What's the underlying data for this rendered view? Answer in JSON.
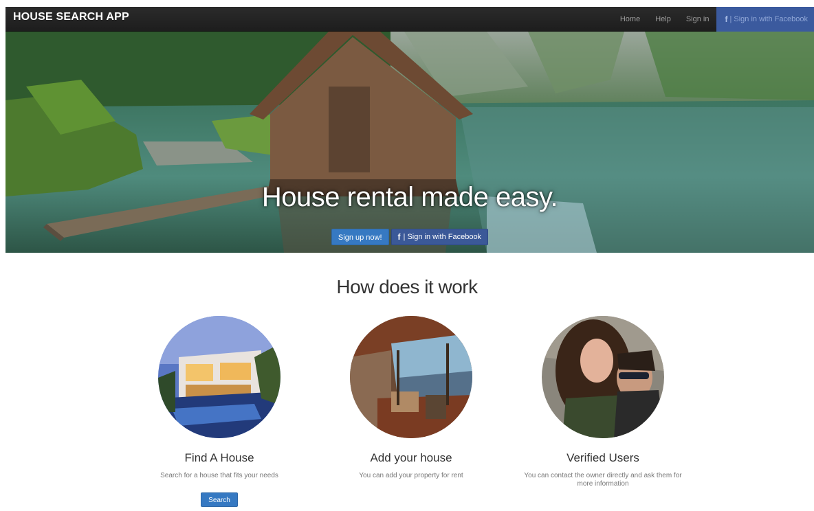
{
  "navbar": {
    "brand": "HOUSE SEARCH APP",
    "links": [
      "Home",
      "Help",
      "Sign in"
    ],
    "facebook_label": "| Sign in with Facebook",
    "facebook_icon": "f"
  },
  "hero": {
    "headline": "House rental made easy.",
    "signup_label": "Sign up now!",
    "facebook_label": "| Sign in with Facebook",
    "facebook_icon": "f"
  },
  "how": {
    "title": "How does it work",
    "features": [
      {
        "title": "Find A House",
        "text": "Search for a house that fits your needs",
        "button": "Search"
      },
      {
        "title": "Add your house",
        "text": "You can add your property for rent"
      },
      {
        "title": "Verified Users",
        "text": "You can contact the owner directly and ask them for more information"
      }
    ]
  },
  "colors": {
    "navbar": "#222222",
    "facebook": "#3b5998",
    "primary": "#3679c2"
  }
}
